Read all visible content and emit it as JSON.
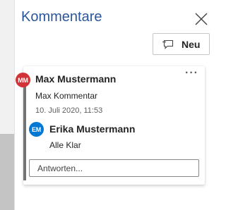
{
  "pane": {
    "title": "Kommentare",
    "new_label": "Neu"
  },
  "thread": {
    "comment": {
      "initials": "MM",
      "author": "Max Mustermann",
      "text": "Max Kommentar",
      "timestamp": "10. Juli 2020, 11:53",
      "more_label": "···"
    },
    "reply": {
      "initials": "EM",
      "author": "Erika Mustermann",
      "text": "Alle Klar"
    },
    "reply_placeholder": "Antworten..."
  },
  "colors": {
    "title": "#2b579a",
    "avatar_mm": "#d13438",
    "avatar_em": "#0078d4",
    "accent": "#737373"
  },
  "icons": {
    "close": "close-icon",
    "new": "new-comment-icon",
    "more": "more-options-icon"
  }
}
